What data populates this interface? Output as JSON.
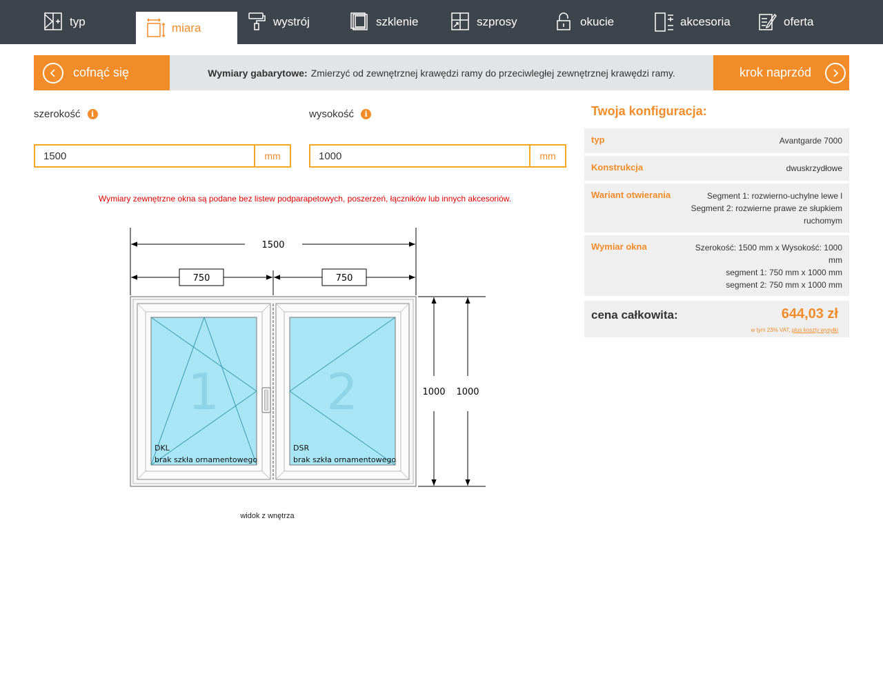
{
  "nav": {
    "tabs": [
      {
        "label": "typ",
        "icon": "window-type-icon"
      },
      {
        "label": "miara",
        "icon": "measure-icon"
      },
      {
        "label": "wystrój",
        "icon": "paint-roller-icon"
      },
      {
        "label": "szklenie",
        "icon": "glazing-icon"
      },
      {
        "label": "szprosy",
        "icon": "muntins-icon"
      },
      {
        "label": "okucie",
        "icon": "padlock-icon"
      },
      {
        "label": "akcesoria",
        "icon": "accessories-icon"
      },
      {
        "label": "oferta",
        "icon": "offer-icon"
      }
    ],
    "active": "miara"
  },
  "stepbar": {
    "back_label": "cofnąć się",
    "next_label": "krok naprzód",
    "info_title": "Wymiary gabarytowe:",
    "info_text": "Zmierzyć od zewnętrznej krawędzi ramy do przeciwległej zewnętrznej krawędzi ramy."
  },
  "dimensions": {
    "width_label": "szerokość",
    "width_value": "1500",
    "width_unit": "mm",
    "height_label": "wysokość",
    "height_value": "1000",
    "height_unit": "mm",
    "info_glyph": "i"
  },
  "warning": "Wymiary zewnętrzne okna są podane bez listew podparapetowych, poszerzeń, łączników lub innych akcesoriów.",
  "drawing": {
    "total_width": "1500",
    "segment_widths": [
      "750",
      "750"
    ],
    "heights": [
      "1000",
      "1000"
    ],
    "segments": [
      {
        "number": "1",
        "code": "DKL",
        "glass": "brak szkła ornamentowego"
      },
      {
        "number": "2",
        "code": "DSR",
        "glass": "brak szkła ornamentowego"
      }
    ],
    "caption": "widok z wnętrza",
    "glass_color": "#a8e6f5",
    "line_color": "#3a9aab"
  },
  "config": {
    "title": "Twoja konfiguracja:",
    "rows": [
      {
        "key": "typ",
        "value": "Avantgarde 7000"
      },
      {
        "key": "Konstrukcja",
        "value": "dwuskrzydłowe"
      },
      {
        "key": "Wariant otwierania",
        "lines": [
          "Segment 1: rozwierno-uchylne lewe l",
          "Segment 2: rozwierne prawe ze słupkiem",
          "ruchomym"
        ]
      },
      {
        "key": "Wymiar okna",
        "lines": [
          "Szerokość: 1500 mm x Wysokość: 1000",
          "mm",
          "segment 1: 750 mm x 1000 mm",
          "segment 2: 750 mm x 1000 mm"
        ]
      }
    ],
    "price_label": "cena całkowita:",
    "price_value": "644,03 zł",
    "price_note_prefix": "w tym 23% VAT,",
    "price_note_link": "plus koszty wysyłki"
  },
  "colors": {
    "accent": "#f28c28",
    "nav_bg": "#3d444b",
    "warning": "#e00000"
  }
}
